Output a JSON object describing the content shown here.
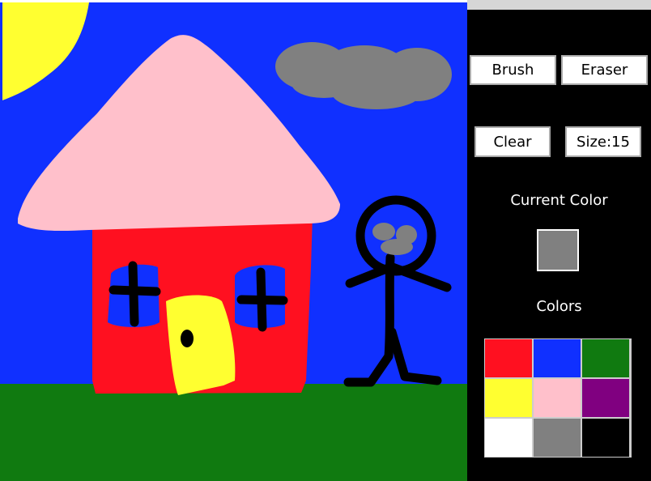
{
  "toolbar": {
    "brush_label": "Brush",
    "eraser_label": "Eraser",
    "clear_label": "Clear",
    "size_label": "Size:15"
  },
  "current_color": {
    "heading": "Current Color",
    "value": "#808080"
  },
  "palette": {
    "heading": "Colors",
    "colors": [
      "#ff1020",
      "#1030ff",
      "#107a10",
      "#ffff30",
      "#ffc0cb",
      "#800080",
      "#ffffff",
      "#808080",
      "#000000"
    ]
  },
  "drawing_colors": {
    "sky": "#1030ff",
    "grass": "#107a10",
    "sun": "#ffff30",
    "roof": "#ffc0cb",
    "walls": "#ff1020",
    "door": "#ffff30",
    "cloud": "#808080",
    "lines": "#000000"
  }
}
